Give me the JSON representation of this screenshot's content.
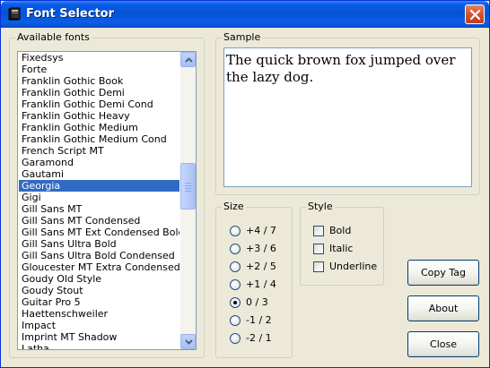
{
  "window": {
    "title": "Font Selector"
  },
  "fonts_group": {
    "label": "Available fonts",
    "items": [
      "Fixedsys",
      "Forte",
      "Franklin Gothic Book",
      "Franklin Gothic Demi",
      "Franklin Gothic Demi Cond",
      "Franklin Gothic Heavy",
      "Franklin Gothic Medium",
      "Franklin Gothic Medium Cond",
      "French Script MT",
      "Garamond",
      "Gautami",
      "Georgia",
      "Gigi",
      "Gill Sans MT",
      "Gill Sans MT Condensed",
      "Gill Sans MT Ext Condensed Bold",
      "Gill Sans Ultra Bold",
      "Gill Sans Ultra Bold Condensed",
      "Gloucester MT Extra Condensed",
      "Goudy Old Style",
      "Goudy Stout",
      "Guitar Pro 5",
      "Haettenschweiler",
      "Impact",
      "Imprint MT Shadow",
      "Latha"
    ],
    "selected": "Georgia"
  },
  "sample_group": {
    "label": "Sample",
    "text": "The quick brown fox jumped over the lazy dog."
  },
  "size_group": {
    "label": "Size",
    "options": [
      "+4 / 7",
      "+3 / 6",
      "+2 / 5",
      "+1 / 4",
      "0 / 3",
      "-1 / 2",
      "-2 / 1"
    ],
    "selected": "0 / 3"
  },
  "style_group": {
    "label": "Style",
    "options": [
      {
        "label": "Bold",
        "checked": false
      },
      {
        "label": "Italic",
        "checked": false
      },
      {
        "label": "Underline",
        "checked": false
      }
    ]
  },
  "buttons": {
    "copy_tag": "Copy Tag",
    "about": "About",
    "close": "Close"
  },
  "colors": {
    "selection": "#316ac5",
    "titlebar": "#0453d8",
    "close_button": "#d8512e"
  }
}
